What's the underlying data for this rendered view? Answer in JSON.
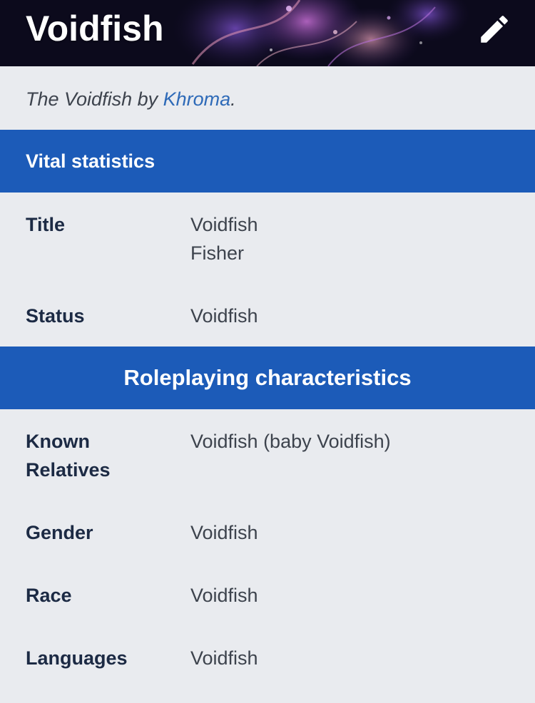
{
  "page": {
    "title": "Voidfish"
  },
  "caption": {
    "prefix": "The Voidfish by ",
    "author_link": "Khroma",
    "suffix": "."
  },
  "sections": {
    "vital": {
      "heading": "Vital statistics",
      "rows": [
        {
          "label": "Title",
          "values": [
            "Voidfish",
            "Fisher"
          ]
        },
        {
          "label": "Status",
          "values": [
            "Voidfish"
          ]
        }
      ]
    },
    "roleplaying": {
      "heading": "Roleplaying characteristics",
      "rows": [
        {
          "label_lines": [
            "Known",
            "Relatives"
          ],
          "values": [
            "Voidfish (baby Voidfish)"
          ]
        },
        {
          "label": "Gender",
          "values": [
            "Voidfish"
          ]
        },
        {
          "label": "Race",
          "values": [
            "Voidfish"
          ]
        },
        {
          "label": "Languages",
          "values": [
            "Voidfish"
          ]
        }
      ]
    }
  },
  "icons": {
    "edit": "pencil-icon"
  },
  "colors": {
    "section_bar": "#1c5bb8",
    "link": "#2e6ab8",
    "background": "#e9ebef",
    "label_text": "#1c2a44",
    "value_text": "#3d434d"
  }
}
